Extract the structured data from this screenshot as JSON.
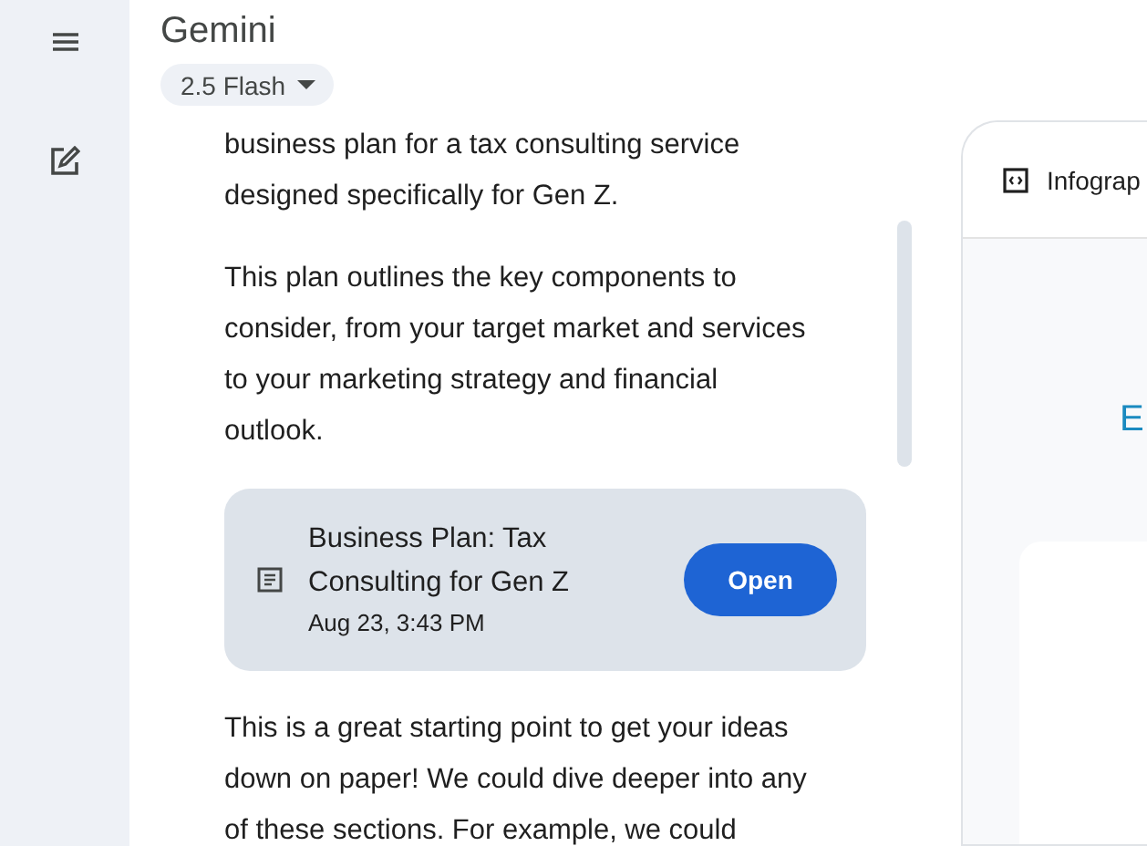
{
  "app": {
    "title": "Gemini",
    "model_selector": "2.5 Flash"
  },
  "chat": {
    "paragraphs_before": [
      {
        "lines": [
          "business plan for a tax consulting service",
          "designed specifically for Gen Z."
        ]
      },
      {
        "lines": [
          "This plan outlines the key components to",
          "consider, from your target market and services",
          "to your marketing strategy and financial",
          "outlook."
        ]
      }
    ],
    "document_card": {
      "title_lines": [
        "Business Plan: Tax",
        "Consulting for Gen Z"
      ],
      "timestamp": "Aug 23, 3:43 PM",
      "button": "Open"
    },
    "paragraphs_after": [
      {
        "lines": [
          "This is a great starting point to get your ideas",
          "down on paper! We could dive deeper into any",
          "of these sections. For example, we could"
        ]
      }
    ]
  },
  "canvas_panel": {
    "tab_title": "Infograp",
    "heading_fragment": "E"
  }
}
